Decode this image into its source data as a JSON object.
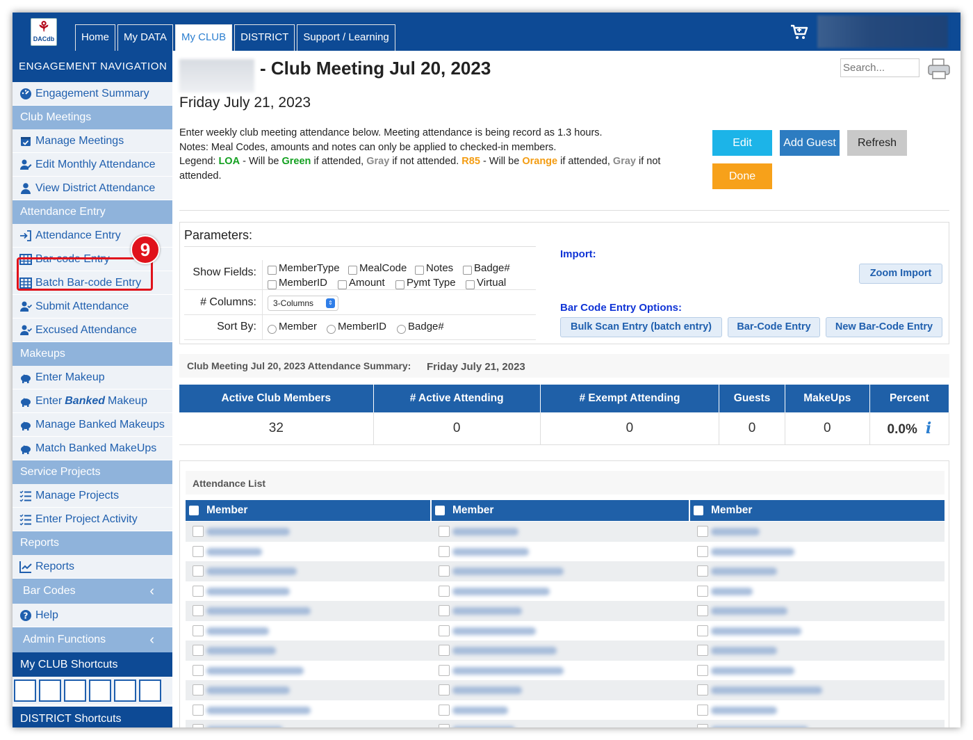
{
  "topnav": {
    "logo_text": "DACdb",
    "tabs": [
      "Home",
      "My DATA",
      "My CLUB",
      "DISTRICT",
      "Support / Learning"
    ],
    "active_tab": "My CLUB"
  },
  "sidebar": {
    "header": "ENGAGEMENT NAVIGATION",
    "engagement_summary": "Engagement Summary",
    "club_meetings": "Club Meetings",
    "manage_meetings": "Manage Meetings",
    "edit_monthly": "Edit Monthly Attendance",
    "view_district": "View District Attendance",
    "attendance_entry_section": "Attendance Entry",
    "attendance_entry": "Attendance Entry",
    "barcode_entry": "Bar-code Entry",
    "batch_barcode": "Batch Bar-code Entry",
    "submit_attendance": "Submit Attendance",
    "excused_attendance": "Excused Attendance",
    "makeups": "Makeups",
    "enter_makeup": "Enter Makeup",
    "enter_banked_pre": "Enter",
    "enter_banked_em": "Banked",
    "enter_banked_post": "Makeup",
    "manage_banked": "Manage Banked Makeups",
    "match_banked": "Match Banked MakeUps",
    "service_projects": "Service Projects",
    "manage_projects": "Manage Projects",
    "enter_project_activity": "Enter Project Activity",
    "reports_section": "Reports",
    "reports": "Reports",
    "bar_codes": "Bar Codes",
    "help": "Help",
    "admin_functions": "Admin Functions",
    "my_club_shortcuts": "My CLUB Shortcuts",
    "district_shortcuts": "DISTRICT Shortcuts",
    "callout_number": "9"
  },
  "page": {
    "title": "- Club Meeting Jul 20, 2023",
    "search_placeholder": "Search...",
    "date": "Friday July 21, 2023",
    "intro_line1": "Enter weekly club meeting attendance below. Meeting attendance is being record as 1.3 hours.",
    "intro_line2": "Notes: Meal Codes, amounts and notes can only be applied to checked-in members.",
    "legend": {
      "prefix": "Legend:",
      "loa": "LOA",
      "t1": "- Will be",
      "green": "Green",
      "t2": "if attended,",
      "gray1": "Gray",
      "t3": "if not attended.",
      "r85": "R85",
      "t4": "- Will be",
      "orange": "Orange",
      "t5": "if attended,",
      "gray2": "Gray",
      "t6": "if not attended."
    },
    "buttons": {
      "edit": "Edit",
      "add_guest": "Add Guest",
      "refresh": "Refresh",
      "done": "Done"
    },
    "colors": {
      "edit": "#1cb4e8",
      "add_guest": "#2d7cc1",
      "refresh": "#c9c9c9",
      "done": "#f7a11a"
    }
  },
  "params": {
    "title": "Parameters:",
    "show_fields_label": "Show Fields:",
    "fields": [
      "MemberType",
      "MealCode",
      "Notes",
      "Badge#",
      "MemberID",
      "Amount",
      "Pymt Type",
      "Virtual"
    ],
    "columns_label": "# Columns:",
    "columns_value": "3-Columns",
    "sort_label": "Sort By:",
    "sort_options": [
      "Member",
      "MemberID",
      "Badge#"
    ],
    "import_label": "Import:",
    "zoom_import": "Zoom Import",
    "barcode_options_label": "Bar Code Entry Options:",
    "bulk_scan": "Bulk Scan Entry (batch entry)",
    "barcode_entry": "Bar-Code Entry",
    "new_barcode_entry": "New Bar-Code Entry"
  },
  "summary": {
    "label": "Club Meeting Jul 20, 2023 Attendance Summary:",
    "date": "Friday July 21, 2023",
    "headers": [
      "Active Club Members",
      "# Active Attending",
      "# Exempt Attending",
      "Guests",
      "MakeUps",
      "Percent"
    ],
    "values": [
      "32",
      "0",
      "0",
      "0",
      "0",
      "0.0%"
    ],
    "info_icon": "i"
  },
  "attendance": {
    "label": "Attendance List",
    "column_header": "Member"
  }
}
